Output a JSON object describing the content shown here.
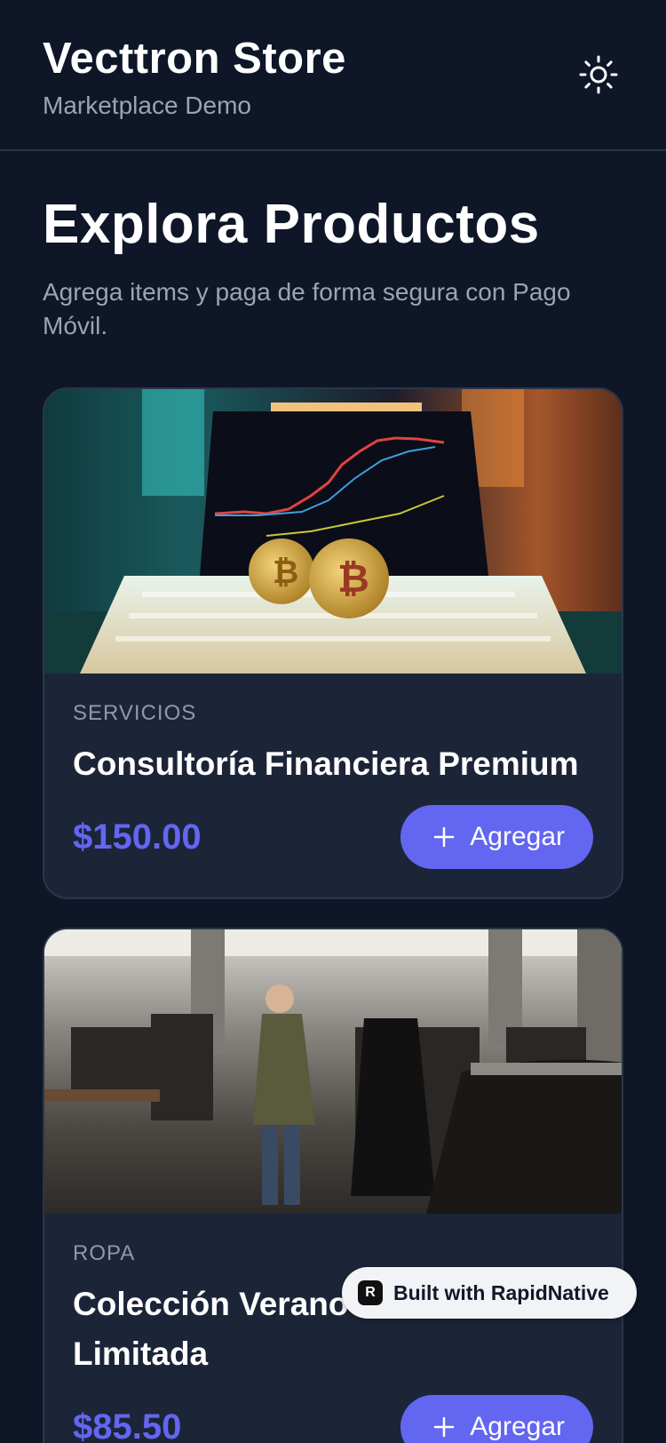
{
  "header": {
    "title": "Vecttron Store",
    "subtitle": "Marketplace Demo",
    "theme_icon": "sun-icon"
  },
  "main": {
    "title": "Explora Productos",
    "description": "Agrega items y paga de forma segura con Pago Móvil."
  },
  "products": [
    {
      "category": "SERVICIOS",
      "name": "Consultoría Financiera Premium",
      "price": "$150.00",
      "add_label": "Agregar",
      "image_icon": "crypto-laptop-photo"
    },
    {
      "category": "ROPA",
      "name": "Colección Verano Limitada",
      "price": "$85.50",
      "add_label": "Agregar",
      "image_icon": "clothing-store-photo"
    }
  ],
  "badge": {
    "label": "Built with RapidNative",
    "logo_letter": "R"
  },
  "colors": {
    "background": "#0e1628",
    "card": "#1c2538",
    "accent": "#6366f1",
    "muted_text": "#9aa4b5"
  }
}
